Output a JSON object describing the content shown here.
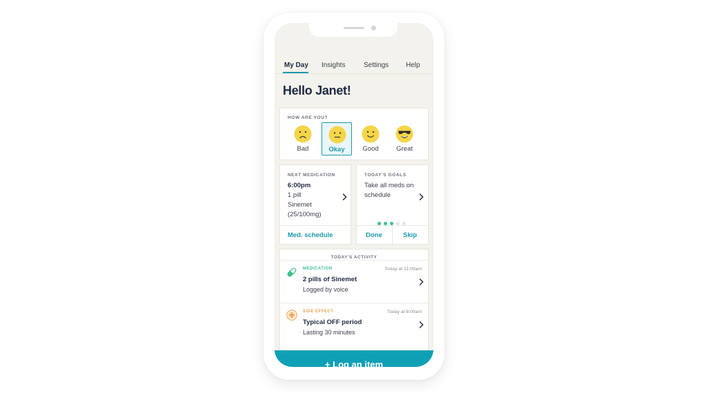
{
  "nav": {
    "tabs": [
      {
        "label": "My Day",
        "active": true
      },
      {
        "label": "Insights",
        "active": false
      },
      {
        "label": "Settings",
        "active": false
      },
      {
        "label": "Help",
        "active": false
      }
    ]
  },
  "greeting": "Hello Janet!",
  "mood": {
    "heading": "HOW ARE YOU?",
    "options": [
      {
        "label": "Bad",
        "icon": "sad-face-icon"
      },
      {
        "label": "Okay",
        "icon": "neutral-face-icon"
      },
      {
        "label": "Good",
        "icon": "smile-face-icon"
      },
      {
        "label": "Great",
        "icon": "sunglasses-face-icon"
      }
    ],
    "selected": "Okay"
  },
  "next_medication": {
    "heading": "NEXT MEDICATION",
    "time": "6:00pm",
    "dose": "1 pill",
    "name": "Sinemet",
    "strength": "(25/100mg)",
    "link": "Med. schedule"
  },
  "goals": {
    "heading": "TODAY'S GOALS",
    "text": "Take all meds on schedule",
    "progress": {
      "completed": 3,
      "total": 5
    },
    "done_label": "Done",
    "skip_label": "Skip"
  },
  "activity": {
    "heading": "TODAY'S ACTIVITY",
    "items": [
      {
        "category": "MEDICATION",
        "time": "Today at 11:00am",
        "title": "2 pills of Sinemet",
        "subtitle": "Logged by voice",
        "icon": "pill-icon",
        "color": "#3dbf8e"
      },
      {
        "category": "SIDE EFFECT",
        "time": "Today at 8:00am",
        "title": "Typical OFF period",
        "subtitle": "Lasting 30 minutes",
        "icon": "plus-circle-icon",
        "color": "#f0a050"
      }
    ]
  },
  "log_button": "+ Log an item",
  "colors": {
    "accent": "#1a9aae",
    "button": "#0fa0b5",
    "emoji": "#f5d548",
    "dot_active": "#3dbf8e",
    "dot_inactive": "#e3e3e3"
  }
}
